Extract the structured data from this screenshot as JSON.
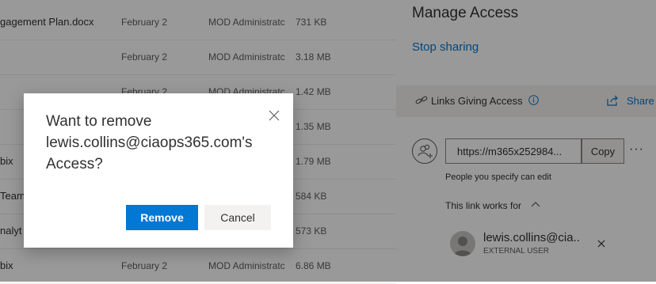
{
  "file_list": {
    "rows": [
      {
        "name": "gagement Plan.docx",
        "date": "February 2",
        "owner": "MOD Administratc",
        "size": "731 KB"
      },
      {
        "name": "",
        "date": "February 2",
        "owner": "MOD Administratc",
        "size": "3.18 MB"
      },
      {
        "name": "",
        "date": "February 2",
        "owner": "MOD Administratc",
        "size": "1.42 MB"
      },
      {
        "name": "",
        "date": "",
        "owner": "",
        "size": "1.35 MB"
      },
      {
        "name": "bix",
        "date": "",
        "owner": "",
        "size": "1.79 MB"
      },
      {
        "name": "Team",
        "date": "",
        "owner": "",
        "size": "584 KB"
      },
      {
        "name": "nalyt",
        "date": "",
        "owner": "",
        "size": "573 KB"
      },
      {
        "name": "bix",
        "date": "February 2",
        "owner": "MOD Administratc",
        "size": "6.86 MB"
      }
    ]
  },
  "panel": {
    "title": "Manage Access",
    "stop_sharing": "Stop sharing",
    "links_label": "Links Giving Access",
    "share_label": "Share",
    "link_url": "https://m365x252984...",
    "copy_label": "Copy",
    "more_label": "···",
    "link_permission": "People you specify can edit",
    "works_for_label": "This link works for",
    "user_name": "lewis.collins@cia...",
    "user_type": "EXTERNAL USER"
  },
  "dialog": {
    "title": "Want to remove lewis.collins@ciaops365.com's Access?",
    "remove_label": "Remove",
    "cancel_label": "Cancel"
  },
  "colors": {
    "accent": "#0078d4",
    "overlay": "rgba(0,0,0,0.4)"
  }
}
